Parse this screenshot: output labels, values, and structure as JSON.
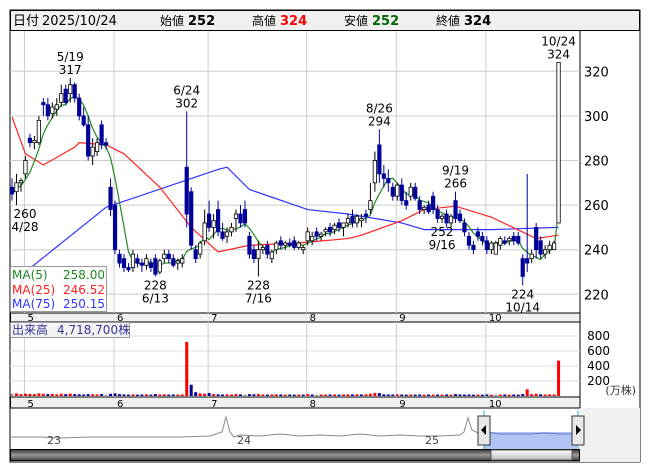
{
  "header": {
    "date_label": "日付",
    "date": "2025/10/24",
    "open_label": "始値",
    "open": "252",
    "high_label": "高値",
    "high": "324",
    "low_label": "安値",
    "low": "252",
    "close_label": "終値",
    "close": "324"
  },
  "legend": {
    "ma5_label": "MA(5)",
    "ma5_value": "258.00",
    "ma25_label": "MA(25)",
    "ma25_value": "246.52",
    "ma75_label": "MA(75)",
    "ma75_value": "250.15"
  },
  "volume_legend": {
    "label": "出来高",
    "value": "4,718,700株"
  },
  "volume_unit": "(万株)",
  "navigator": {
    "year_labels": [
      "23",
      "24",
      "25"
    ]
  },
  "colors": {
    "up_vol": "#ff0000",
    "down": "#000099",
    "flat": "#999999",
    "ma5": "#228822",
    "ma25": "#ff2222",
    "ma75": "#3333ff",
    "high": "#ff0000",
    "low": "#006600"
  },
  "chart_data": {
    "type": "candlestick",
    "price_axis": {
      "ticks": [
        220,
        240,
        260,
        280,
        300,
        320
      ]
    },
    "volume_axis": {
      "ticks": [
        200,
        400,
        600,
        800
      ],
      "unit": "(万株)"
    },
    "month_labels": [
      {
        "label": "5",
        "index": 3
      },
      {
        "label": "6",
        "index": 23
      },
      {
        "label": "7",
        "index": 44
      },
      {
        "label": "8",
        "index": 66
      },
      {
        "label": "9",
        "index": 86
      },
      {
        "label": "10",
        "index": 106
      }
    ],
    "annotations": [
      {
        "date": "5/19",
        "value": "317",
        "kind": "high"
      },
      {
        "date": "6/24",
        "value": "302",
        "kind": "high"
      },
      {
        "date": "8/26",
        "value": "294",
        "kind": "high"
      },
      {
        "date": "9/19",
        "value": "266",
        "kind": "high"
      },
      {
        "date": "10/24",
        "value": "324",
        "kind": "high"
      },
      {
        "date": "4/28",
        "value": "260",
        "kind": "low"
      },
      {
        "date": "6/13",
        "value": "228",
        "kind": "low"
      },
      {
        "date": "7/16",
        "value": "228",
        "kind": "low"
      },
      {
        "date": "9/16",
        "value": "252",
        "kind": "low"
      },
      {
        "date": "10/14",
        "value": "224",
        "kind": "low"
      }
    ],
    "ma25_points": [
      [
        0,
        299.5
      ],
      [
        3,
        283
      ],
      [
        7,
        278
      ],
      [
        14,
        286
      ],
      [
        15,
        288
      ],
      [
        21,
        287
      ],
      [
        25,
        283
      ],
      [
        33,
        268
      ],
      [
        40,
        250
      ],
      [
        46,
        239
      ],
      [
        53,
        242
      ],
      [
        64,
        243
      ],
      [
        75,
        245
      ],
      [
        78,
        246.5
      ],
      [
        87,
        253
      ],
      [
        92,
        258
      ],
      [
        99,
        259.5
      ],
      [
        107,
        254.6
      ],
      [
        117,
        245
      ],
      [
        122,
        246.5
      ]
    ],
    "ma75_points": [
      [
        0,
        215
      ],
      [
        3.6,
        231
      ],
      [
        21,
        259
      ],
      [
        46,
        276
      ],
      [
        48,
        277
      ],
      [
        53,
        267
      ],
      [
        66,
        258
      ],
      [
        75,
        256
      ],
      [
        87,
        252
      ],
      [
        92,
        249
      ],
      [
        107,
        249
      ],
      [
        122,
        250
      ]
    ],
    "candles": [
      [
        "4/25",
        268,
        272,
        262,
        265,
        30
      ],
      [
        "4/28",
        266,
        274,
        260,
        270,
        35
      ],
      [
        "4/30",
        270,
        272,
        266,
        271,
        25
      ],
      [
        "5/1",
        274,
        282,
        272,
        280,
        30
      ],
      [
        "5/2",
        290,
        292,
        286,
        288,
        28
      ],
      [
        "5/7",
        288,
        291,
        285,
        289,
        25
      ],
      [
        "5/8",
        288,
        300,
        287,
        298,
        35
      ],
      [
        "5/9",
        306,
        308,
        300,
        305,
        30
      ],
      [
        "5/12",
        305,
        308,
        298,
        300,
        25
      ],
      [
        "5/13",
        301,
        306,
        299,
        304,
        28
      ],
      [
        "5/14",
        303,
        308,
        300,
        305,
        22
      ],
      [
        "5/15",
        306,
        314,
        304,
        310,
        30
      ],
      [
        "5/16",
        312,
        314,
        305,
        306,
        25
      ],
      [
        "5/19",
        310,
        317,
        306,
        314,
        32
      ],
      [
        "5/20",
        314,
        315,
        306,
        308,
        25
      ],
      [
        "5/21",
        308,
        310,
        298,
        300,
        22
      ],
      [
        "5/22",
        300,
        304,
        295,
        296,
        20
      ],
      [
        "5/23",
        296,
        300,
        280,
        282,
        25
      ],
      [
        "5/26",
        282,
        290,
        278,
        286,
        22
      ],
      [
        "5/27",
        284,
        290,
        282,
        288,
        20
      ],
      [
        "5/28",
        296,
        298,
        285,
        287,
        25
      ],
      [
        "5/29",
        288,
        290,
        285,
        287,
        18
      ],
      [
        "5/30",
        268,
        272,
        255,
        258,
        30
      ],
      [
        "6/2",
        260,
        262,
        238,
        240,
        35
      ],
      [
        "6/3",
        238,
        240,
        232,
        234,
        25
      ],
      [
        "6/4",
        236,
        238,
        230,
        232,
        20
      ],
      [
        "6/5",
        232,
        234,
        230,
        231,
        18
      ],
      [
        "6/6",
        232,
        240,
        230,
        238,
        22
      ],
      [
        "6/9",
        236,
        238,
        232,
        234,
        18
      ],
      [
        "6/10",
        234,
        236,
        230,
        233,
        20
      ],
      [
        "6/11",
        233,
        238,
        231,
        236,
        22
      ],
      [
        "6/12",
        234,
        236,
        230,
        232,
        18
      ],
      [
        "6/13",
        236,
        238,
        228,
        229,
        25
      ],
      [
        "6/16",
        230,
        236,
        229,
        235,
        20
      ],
      [
        "6/17",
        236,
        240,
        234,
        238,
        22
      ],
      [
        "6/18",
        238,
        240,
        234,
        236,
        18
      ],
      [
        "6/19",
        236,
        238,
        232,
        233,
        20
      ],
      [
        "6/20",
        234,
        236,
        231,
        235,
        18
      ],
      [
        "6/23",
        234,
        238,
        232,
        236,
        20
      ],
      [
        "6/24",
        277,
        302,
        250,
        256,
        720
      ],
      [
        "6/25",
        266,
        268,
        240,
        242,
        150
      ],
      [
        "6/26",
        240,
        242,
        234,
        236,
        50
      ],
      [
        "6/27",
        238,
        244,
        236,
        243,
        35
      ],
      [
        "6/30",
        244,
        258,
        242,
        252,
        30
      ],
      [
        "7/1",
        256,
        262,
        248,
        250,
        40
      ],
      [
        "7/2",
        250,
        256,
        245,
        253,
        25
      ],
      [
        "7/3",
        258,
        262,
        246,
        248,
        22
      ],
      [
        "7/4",
        248,
        252,
        244,
        245,
        20
      ],
      [
        "7/7",
        246,
        250,
        243,
        248,
        22
      ],
      [
        "7/8",
        248,
        252,
        246,
        250,
        20
      ],
      [
        "7/9",
        254,
        258,
        248,
        256,
        25
      ],
      [
        "7/10",
        256,
        260,
        250,
        252,
        22
      ],
      [
        "7/11",
        258,
        262,
        250,
        252,
        20
      ],
      [
        "7/14",
        246,
        248,
        236,
        238,
        25
      ],
      [
        "7/15",
        240,
        242,
        234,
        236,
        22
      ],
      [
        "7/16",
        236,
        244,
        228,
        240,
        25
      ],
      [
        "7/17",
        240,
        242,
        238,
        241,
        20
      ],
      [
        "7/18",
        242,
        244,
        236,
        238,
        18
      ],
      [
        "7/22",
        236,
        240,
        234,
        239,
        20
      ],
      [
        "7/23",
        240,
        244,
        238,
        243,
        22
      ],
      [
        "7/24",
        244,
        246,
        240,
        242,
        20
      ],
      [
        "7/25",
        242,
        244,
        240,
        243,
        18
      ],
      [
        "7/28",
        243,
        245,
        241,
        242,
        20
      ],
      [
        "7/29",
        244,
        246,
        240,
        241,
        18
      ],
      [
        "7/30",
        241,
        244,
        240,
        243,
        20
      ],
      [
        "7/31",
        240,
        242,
        238,
        241,
        18
      ],
      [
        "8/1",
        244,
        250,
        242,
        248,
        25
      ],
      [
        "8/4",
        244,
        248,
        242,
        246,
        20
      ],
      [
        "8/5",
        248,
        250,
        244,
        246,
        18
      ],
      [
        "8/6",
        246,
        248,
        244,
        247,
        20
      ],
      [
        "8/7",
        248,
        250,
        246,
        249,
        18
      ],
      [
        "8/8",
        250,
        252,
        246,
        248,
        20
      ],
      [
        "8/12",
        249,
        252,
        247,
        251,
        20
      ],
      [
        "8/13",
        252,
        254,
        248,
        250,
        18
      ],
      [
        "8/14",
        250,
        252,
        246,
        252,
        20
      ],
      [
        "8/15",
        252,
        256,
        250,
        254,
        22
      ],
      [
        "8/18",
        255,
        258,
        250,
        252,
        20
      ],
      [
        "8/19",
        252,
        256,
        250,
        255,
        22
      ],
      [
        "8/20",
        253,
        256,
        250,
        254,
        20
      ],
      [
        "8/21",
        256,
        258,
        252,
        255,
        22
      ],
      [
        "8/22",
        258,
        270,
        256,
        262,
        30
      ],
      [
        "8/25",
        270,
        284,
        266,
        280,
        40
      ],
      [
        "8/26",
        287,
        294,
        270,
        274,
        38
      ],
      [
        "8/27",
        274,
        278,
        268,
        272,
        22
      ],
      [
        "8/28",
        272,
        276,
        266,
        270,
        20
      ],
      [
        "8/29",
        268,
        270,
        262,
        264,
        20
      ],
      [
        "9/1",
        264,
        270,
        262,
        269,
        22
      ],
      [
        "9/2",
        269,
        272,
        260,
        262,
        20
      ],
      [
        "9/3",
        262,
        266,
        258,
        260,
        18
      ],
      [
        "9/4",
        264,
        270,
        262,
        268,
        20
      ],
      [
        "9/5",
        268,
        270,
        262,
        263,
        18
      ],
      [
        "9/8",
        262,
        264,
        256,
        258,
        20
      ],
      [
        "9/9",
        258,
        260,
        256,
        259,
        18
      ],
      [
        "9/10",
        260,
        262,
        256,
        257,
        20
      ],
      [
        "9/11",
        264,
        266,
        256,
        258,
        18
      ],
      [
        "9/12",
        258,
        260,
        252,
        254,
        20
      ],
      [
        "9/16",
        254,
        256,
        252,
        255,
        18
      ],
      [
        "9/17",
        256,
        258,
        250,
        252,
        20
      ],
      [
        "9/18",
        252,
        256,
        250,
        255,
        18
      ],
      [
        "9/19",
        262,
        266,
        252,
        254,
        25
      ],
      [
        "9/22",
        256,
        258,
        252,
        253,
        20
      ],
      [
        "9/24",
        252,
        254,
        246,
        248,
        18
      ],
      [
        "9/25",
        246,
        248,
        240,
        242,
        20
      ],
      [
        "9/26",
        242,
        244,
        238,
        240,
        18
      ],
      [
        "9/29",
        248,
        250,
        244,
        246,
        20
      ],
      [
        "9/30",
        246,
        248,
        242,
        244,
        18
      ],
      [
        "10/1",
        244,
        246,
        238,
        240,
        20
      ],
      [
        "10/2",
        240,
        244,
        238,
        243,
        18
      ],
      [
        "10/3",
        238,
        244,
        238,
        243,
        20
      ],
      [
        "10/6",
        242,
        246,
        240,
        245,
        18
      ],
      [
        "10/7",
        244,
        246,
        242,
        243,
        20
      ],
      [
        "10/8",
        244,
        246,
        242,
        245,
        18
      ],
      [
        "10/9",
        246,
        248,
        242,
        244,
        20
      ],
      [
        "10/10",
        246,
        248,
        242,
        243,
        18
      ],
      [
        "10/14",
        236,
        238,
        224,
        228,
        25
      ],
      [
        "10/15",
        236,
        274,
        230,
        234,
        90
      ],
      [
        "10/16",
        236,
        240,
        234,
        238,
        25
      ],
      [
        "10/17",
        250,
        252,
        236,
        240,
        30
      ],
      [
        "10/20",
        244,
        246,
        236,
        238,
        22
      ],
      [
        "10/21",
        238,
        242,
        236,
        240,
        20
      ],
      [
        "10/22",
        240,
        244,
        238,
        242,
        22
      ],
      [
        "10/23",
        240,
        244,
        240,
        243,
        20
      ],
      [
        "10/24",
        252,
        324,
        252,
        324,
        472
      ]
    ]
  }
}
